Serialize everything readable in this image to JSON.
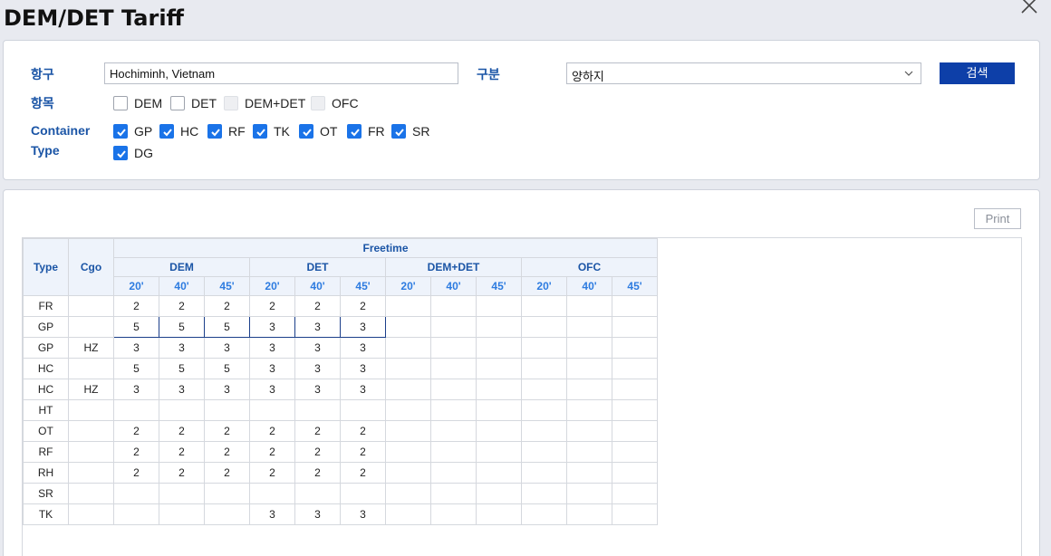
{
  "page": {
    "title": "DEM/DET Tariff"
  },
  "search": {
    "port_label": "항구",
    "port_value": "Hochiminh, Vietnam",
    "type_label": "구분",
    "type_value": "양하지",
    "search_button": "검색",
    "items_label": "항목",
    "items": [
      {
        "label": "DEM",
        "state": "unchecked"
      },
      {
        "label": "DET",
        "state": "unchecked"
      },
      {
        "label": "DEM+DET",
        "state": "disabled"
      },
      {
        "label": "OFC",
        "state": "disabled"
      }
    ],
    "container_label_1": "Container",
    "container_label_2": "Type",
    "container_types": [
      "GP",
      "HC",
      "RF",
      "TK",
      "OT",
      "FR",
      "SR",
      "DG"
    ]
  },
  "result": {
    "print_button": "Print",
    "headers": {
      "type": "Type",
      "cgo": "Cgo",
      "freetime": "Freetime",
      "groups": [
        "DEM",
        "DET",
        "DEM+DET",
        "OFC"
      ],
      "sizes": [
        "20'",
        "40'",
        "45'"
      ]
    },
    "rows": [
      {
        "type": "FR",
        "cgo": "",
        "values": [
          "2",
          "2",
          "2",
          "2",
          "2",
          "2",
          "",
          "",
          "",
          "",
          "",
          ""
        ]
      },
      {
        "type": "GP",
        "cgo": "",
        "values": [
          "5",
          "5",
          "5",
          "3",
          "3",
          "3",
          "",
          "",
          "",
          "",
          "",
          ""
        ]
      },
      {
        "type": "GP",
        "cgo": "HZ",
        "values": [
          "3",
          "3",
          "3",
          "3",
          "3",
          "3",
          "",
          "",
          "",
          "",
          "",
          ""
        ]
      },
      {
        "type": "HC",
        "cgo": "",
        "values": [
          "5",
          "5",
          "5",
          "3",
          "3",
          "3",
          "",
          "",
          "",
          "",
          "",
          ""
        ]
      },
      {
        "type": "HC",
        "cgo": "HZ",
        "values": [
          "3",
          "3",
          "3",
          "3",
          "3",
          "3",
          "",
          "",
          "",
          "",
          "",
          ""
        ]
      },
      {
        "type": "HT",
        "cgo": "",
        "values": [
          "",
          "",
          "",
          "",
          "",
          "",
          "",
          "",
          "",
          "",
          "",
          ""
        ]
      },
      {
        "type": "OT",
        "cgo": "",
        "values": [
          "2",
          "2",
          "2",
          "2",
          "2",
          "2",
          "",
          "",
          "",
          "",
          "",
          ""
        ]
      },
      {
        "type": "RF",
        "cgo": "",
        "values": [
          "2",
          "2",
          "2",
          "2",
          "2",
          "2",
          "",
          "",
          "",
          "",
          "",
          ""
        ]
      },
      {
        "type": "RH",
        "cgo": "",
        "values": [
          "2",
          "2",
          "2",
          "2",
          "2",
          "2",
          "",
          "",
          "",
          "",
          "",
          ""
        ]
      },
      {
        "type": "SR",
        "cgo": "",
        "values": [
          "",
          "",
          "",
          "",
          "",
          "",
          "",
          "",
          "",
          "",
          "",
          ""
        ]
      },
      {
        "type": "TK",
        "cgo": "",
        "values": [
          "",
          "",
          "",
          "3",
          "3",
          "3",
          "",
          "",
          "",
          "",
          "",
          ""
        ]
      }
    ],
    "selected_row": 1
  },
  "colors": {
    "accent": "#1b55a6",
    "button": "#0d3fa8",
    "checkbox": "#1a73e8"
  },
  "icons": {
    "close": "close-icon",
    "dropdown": "chevron-down-icon",
    "check": "check-icon"
  }
}
